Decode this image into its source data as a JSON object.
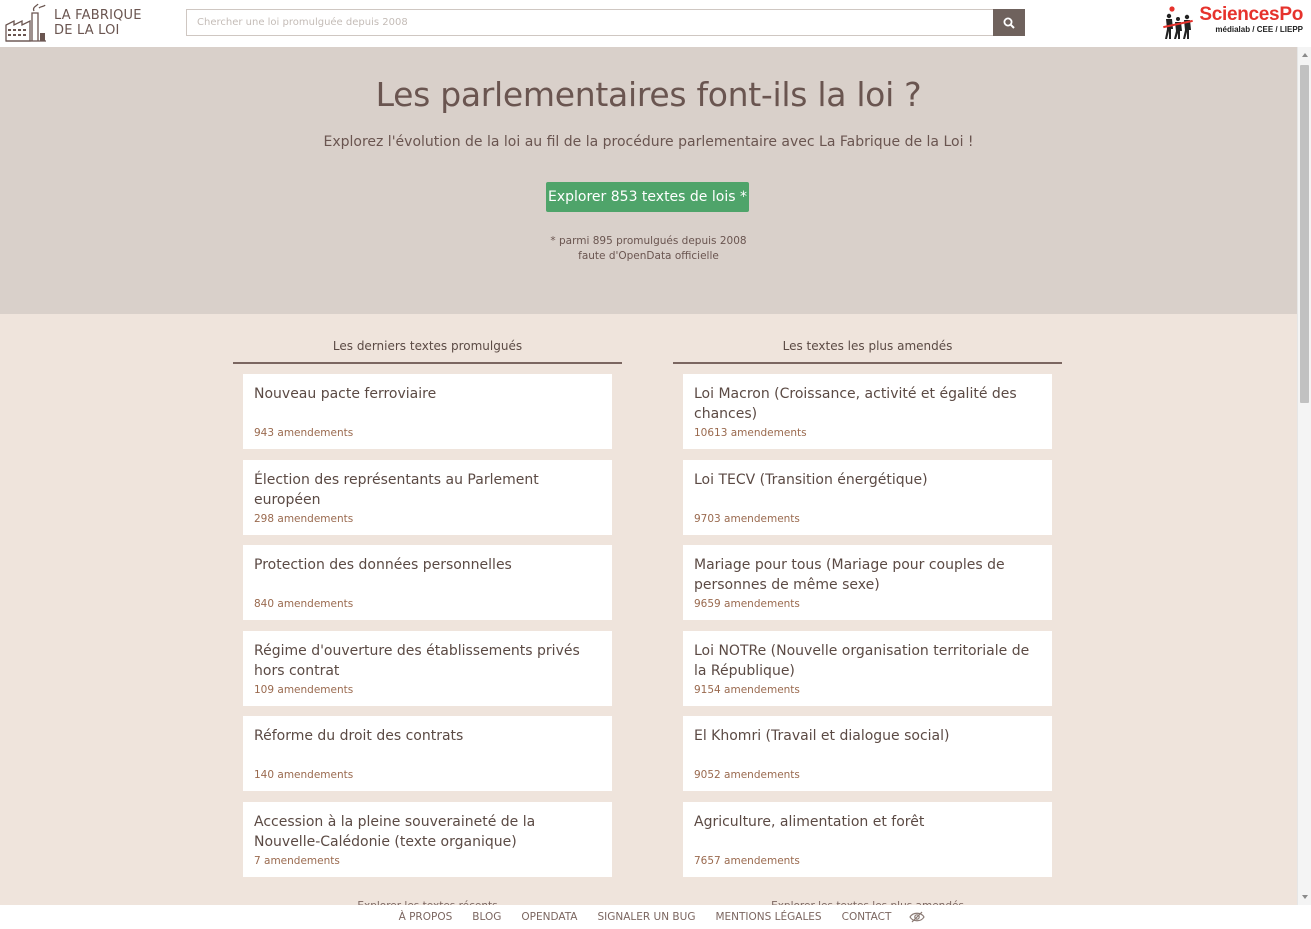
{
  "header": {
    "logo_line1": "LA FABRIQUE",
    "logo_line2": "DE LA LOI",
    "search_placeholder": "Chercher une loi promulguée depuis 2008",
    "partner_title": "SciencesPo",
    "partner_sub": "médialab / CEE / LIEPP"
  },
  "hero": {
    "title": "Les parlementaires font-ils la loi ?",
    "subtitle": "Explorez l'évolution de la loi au fil de la procédure parlementaire avec La Fabrique de la Loi !",
    "button": "Explorer 853 textes de lois *",
    "note_line1": "* parmi 895 promulgués depuis 2008",
    "note_line2": "faute d'OpenData officielle"
  },
  "left_column": {
    "heading": "Les derniers textes promulgués",
    "items": [
      {
        "title": "Nouveau pacte ferroviaire",
        "count": "943 amendements"
      },
      {
        "title": "Élection des représentants au Parlement européen",
        "count": "298 amendements"
      },
      {
        "title": "Protection des données personnelles",
        "count": "840 amendements"
      },
      {
        "title": "Régime d'ouverture des établissements privés hors contrat",
        "count": "109 amendements"
      },
      {
        "title": "Réforme du droit des contrats",
        "count": "140 amendements"
      },
      {
        "title": "Accession à la pleine souveraineté de la Nouvelle-Calédonie (texte organique)",
        "count": "7 amendements"
      }
    ],
    "more": "Explorer les textes récents"
  },
  "right_column": {
    "heading": "Les textes les plus amendés",
    "items": [
      {
        "title": "Loi Macron (Croissance, activité et égalité des chances)",
        "count": "10613 amendements"
      },
      {
        "title": "Loi TECV (Transition énergétique)",
        "count": "9703 amendements"
      },
      {
        "title": "Mariage pour tous (Mariage pour couples de personnes de même sexe)",
        "count": "9659 amendements"
      },
      {
        "title": "Loi NOTRe (Nouvelle organisation territoriale de la République)",
        "count": "9154 amendements"
      },
      {
        "title": "El Khomri (Travail et dialogue social)",
        "count": "9052 amendements"
      },
      {
        "title": "Agriculture, alimentation et forêt",
        "count": "7657 amendements"
      }
    ],
    "more": "Explorer les textes les plus amendés"
  },
  "footer": {
    "links": [
      "À PROPOS",
      "BLOG",
      "OPENDATA",
      "SIGNALER UN BUG",
      "MENTIONS LÉGALES",
      "CONTACT"
    ]
  },
  "colors": {
    "hero_bg": "#d9d0ca",
    "page_bg": "#efe4dc",
    "accent_green": "#4fa46a",
    "amend_count": "#9a6a4f",
    "sciencespo_red": "#e6322c"
  },
  "icons": [
    "factory-logo-icon",
    "search-icon",
    "sciencespo-figures-icon",
    "eye-slash-icon"
  ]
}
